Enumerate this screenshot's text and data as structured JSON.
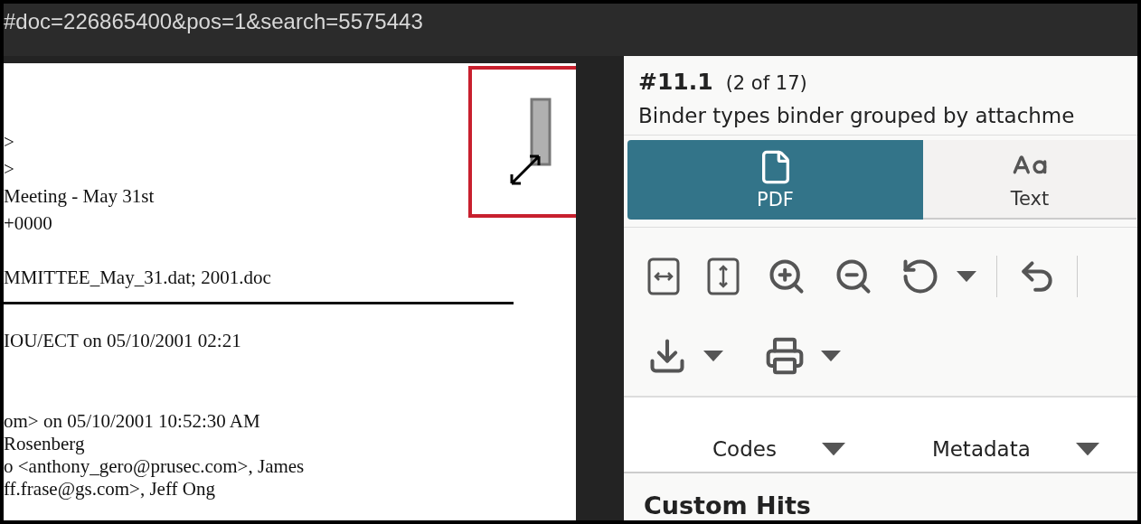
{
  "address_bar": {
    "url": "#doc=226865400&pos=1&search=5575443"
  },
  "document": {
    "blocks": [
      {
        "kind": "text",
        "lines": [
          ">",
          ">",
          "Meeting - May 31st",
          "+0000"
        ]
      },
      {
        "kind": "text",
        "lines": [
          "MMITTEE_May_31.dat; 2001.doc"
        ]
      },
      {
        "kind": "rule"
      },
      {
        "kind": "text",
        "lines": [
          "IOU/ECT on 05/10/2001 02:21"
        ]
      },
      {
        "kind": "text",
        "lines": [
          "om> on 05/10/2001 10:52:30 AM",
          "Rosenberg",
          "o <anthony_gero@prusec.com>, James",
          "ff.frase@gs.com>, Jeff Ong"
        ]
      }
    ]
  },
  "panel": {
    "title": "#11.1",
    "count": "(2 of 17)",
    "subtitle": "Binder types binder grouped by attachme",
    "view_tabs": [
      {
        "label": "PDF",
        "kind": "file",
        "selected": true
      },
      {
        "label": "Text",
        "kind": "font",
        "selected": false
      }
    ],
    "toolbar_rows": [
      [
        {
          "kind": "fit-width",
          "menu": false
        },
        {
          "kind": "fit-height",
          "menu": false
        },
        {
          "kind": "zoom-in",
          "menu": false
        },
        {
          "kind": "zoom-out",
          "menu": false
        },
        {
          "kind": "rotate",
          "menu": true
        },
        {
          "kind": "separator"
        },
        {
          "kind": "undo",
          "menu": false
        },
        {
          "kind": "separator"
        }
      ],
      [
        {
          "kind": "download",
          "menu": true
        },
        {
          "kind": "print",
          "menu": true
        }
      ]
    ],
    "sections": [
      {
        "label": "Codes"
      },
      {
        "label": "Metadata"
      }
    ],
    "heading": "Custom Hits"
  }
}
